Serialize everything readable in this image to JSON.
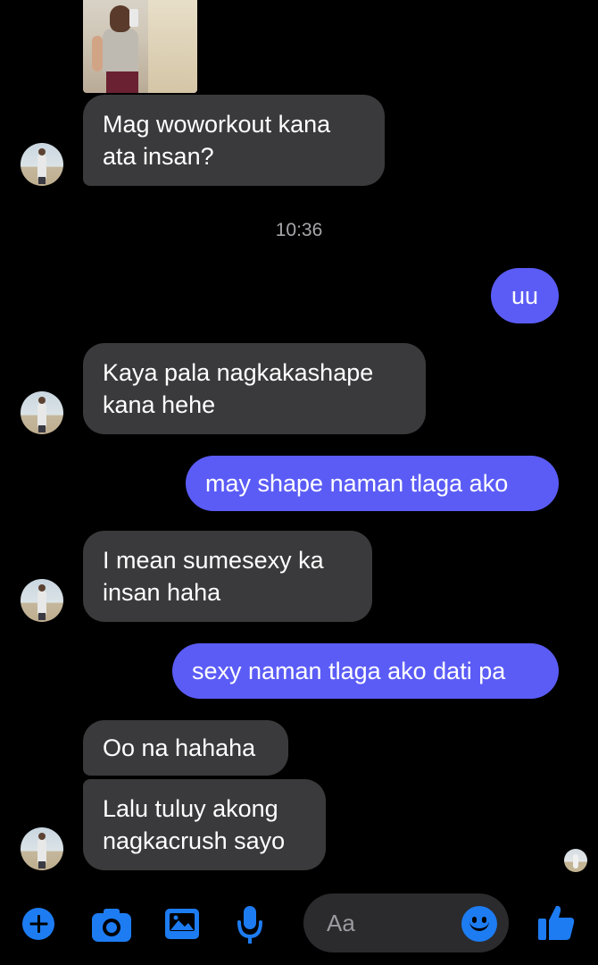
{
  "conversation": {
    "messages": [
      {
        "from": "them",
        "text": "Mag woworkout kana\nata insan?"
      },
      {
        "from": "me",
        "text": "uu"
      },
      {
        "from": "them",
        "text": "Kaya pala nagkakashape\nkana hehe"
      },
      {
        "from": "me",
        "text": "may shape naman tlaga ako"
      },
      {
        "from": "them",
        "text": "I mean sumesexy ka\ninsan haha"
      },
      {
        "from": "me",
        "text": "sexy naman tlaga ako dati pa"
      },
      {
        "from": "them",
        "text": "Oo na hahaha"
      },
      {
        "from": "them",
        "text": "Lalu tuluy akong\nnagkacrush sayo"
      }
    ],
    "timestamp": "10:36"
  },
  "composer": {
    "placeholder": "Aa",
    "icons": [
      "plus-icon",
      "camera-icon",
      "gallery-icon",
      "mic-icon",
      "emoji-icon",
      "thumbs-up-icon"
    ]
  },
  "colors": {
    "background": "#000000",
    "incoming_bubble": "#3a3a3c",
    "outgoing_bubble": "#5b5cf6",
    "accent": "#1d7cf2"
  }
}
